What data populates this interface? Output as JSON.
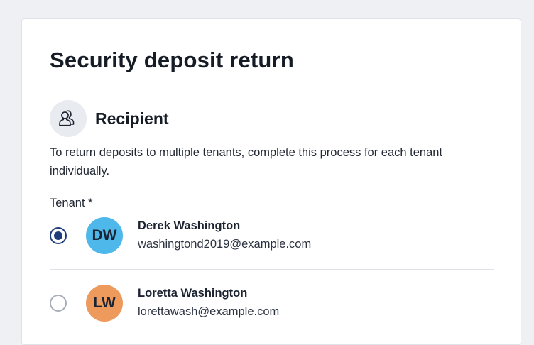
{
  "form": {
    "title": "Security deposit return",
    "section": {
      "title": "Recipient",
      "icon": "users-icon",
      "description": "To return deposits to multiple tenants, complete this process for each tenant individually."
    },
    "tenant_field": {
      "label": "Tenant *",
      "options": [
        {
          "initials": "DW",
          "name": "Derek Washington",
          "email": "washingtond2019@example.com",
          "selected": true,
          "avatar_color": "#4fb8ea"
        },
        {
          "initials": "LW",
          "name": "Loretta Washington",
          "email": "lorettawash@example.com",
          "selected": false,
          "avatar_color": "#ee9a5c"
        }
      ]
    }
  },
  "colors": {
    "accent": "#1f3d7a",
    "background": "#eef0f3",
    "card": "#ffffff"
  }
}
